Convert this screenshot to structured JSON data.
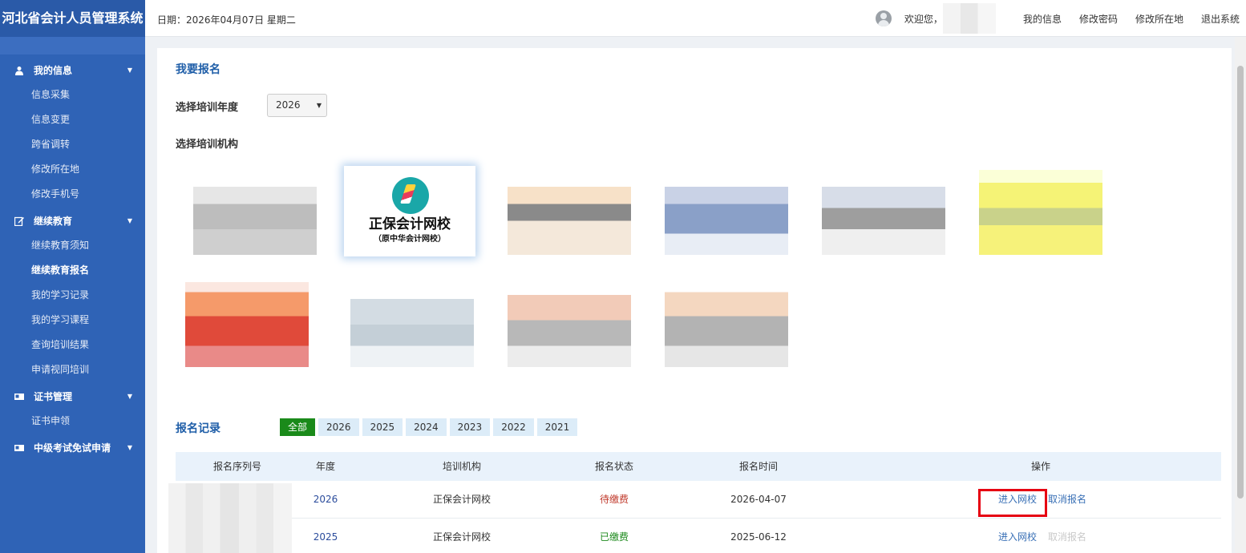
{
  "header": {
    "brand": "河北省会计人员管理系统",
    "date": "日期：2026年04月07日 星期二",
    "welcome": "欢迎您，",
    "links": [
      "我的信息",
      "修改密码",
      "修改所在地",
      "退出系统"
    ]
  },
  "sidebar": {
    "groups": [
      {
        "label": "我的信息",
        "icon": "user-icon",
        "items": [
          "信息采集",
          "信息变更",
          "跨省调转",
          "修改所在地",
          "修改手机号"
        ]
      },
      {
        "label": "继续教育",
        "icon": "edit-icon",
        "items": [
          "继续教育须知",
          "继续教育报名",
          "我的学习记录",
          "我的学习课程",
          "查询培训结果",
          "申请视同培训"
        ],
        "active": "继续教育报名"
      },
      {
        "label": "证书管理",
        "icon": "card-icon",
        "items": [
          "证书申领"
        ]
      },
      {
        "label": "中级考试免试申请",
        "icon": "card-icon",
        "items": []
      }
    ]
  },
  "signup": {
    "title": "我要报名",
    "year_label": "选择培训年度",
    "year_value": "2026",
    "inst_label": "选择培训机构",
    "selected_inst": {
      "name": "正保会计网校",
      "sub": "（原中华会计网校）"
    }
  },
  "records": {
    "title": "报名记录",
    "tabs": [
      "全部",
      "2026",
      "2025",
      "2024",
      "2023",
      "2022",
      "2021"
    ],
    "active_tab": "全部",
    "columns": [
      "报名序列号",
      "年度",
      "培训机构",
      "报名状态",
      "报名时间",
      "操作"
    ],
    "rows": [
      {
        "year": "2026",
        "institution": "正保会计网校",
        "status": "待缴费",
        "time": "2026-04-07",
        "op1": "进入网校",
        "op2": "取消报名"
      },
      {
        "year": "2025",
        "institution": "正保会计网校",
        "status": "已缴费",
        "time": "2025-06-12",
        "op1": "进入网校",
        "op2": "取消报名"
      }
    ]
  },
  "colors": {
    "brand": "#2a5aa8",
    "sidebar": "#2f63b6",
    "title": "#1f5ea8",
    "active_tab": "#1a8a1a",
    "highlight": "#e60012"
  }
}
